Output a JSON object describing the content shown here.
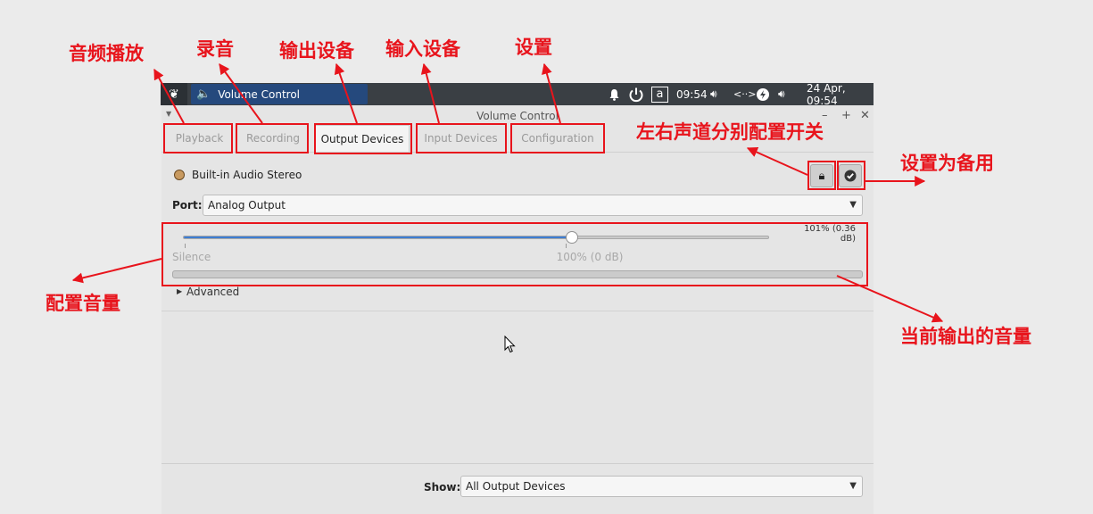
{
  "taskbar": {
    "task_label": "Volume Control",
    "tray_letter": "a",
    "tray_time": "09:54",
    "tray_network": "<··>",
    "datetime": "24 Apr, 09:54"
  },
  "window": {
    "title": "Volume Control",
    "tabs": [
      {
        "label": "Playback",
        "active": false
      },
      {
        "label": "Recording",
        "active": false
      },
      {
        "label": "Output Devices",
        "active": true
      },
      {
        "label": "Input Devices",
        "active": false
      },
      {
        "label": "Configuration",
        "active": false
      }
    ],
    "device": {
      "name": "Built-in Audio Stereo",
      "port_label": "Port:",
      "port_value": "Analog Output",
      "volume_readout": "101% (0.36 dB)",
      "volume_fraction": 0.664,
      "silence_label": "Silence",
      "mark_100_label": "100% (0 dB)",
      "advanced_label": "Advanced"
    },
    "show_label": "Show:",
    "show_value": "All Output Devices"
  },
  "annotations": {
    "playback": "音频播放",
    "recording": "录音",
    "output_devices": "输出设备",
    "input_devices": "输入设备",
    "configuration": "设置",
    "lock_channels": "左右声道分别配置开关",
    "set_fallback": "设置为备用",
    "volume_config": "配置音量",
    "current_output": "当前输出的音量"
  },
  "colors": {
    "annotation_red": "#e8141c",
    "slider_fill": "#3d7dd1",
    "taskbar_bg": "#3a3f44",
    "task_item_bg": "#25497d"
  },
  "icons": {
    "start": "xfce-mouse-icon",
    "task": "speaker-icon",
    "lock": "lock-icon",
    "fallback": "check-circle-icon"
  }
}
